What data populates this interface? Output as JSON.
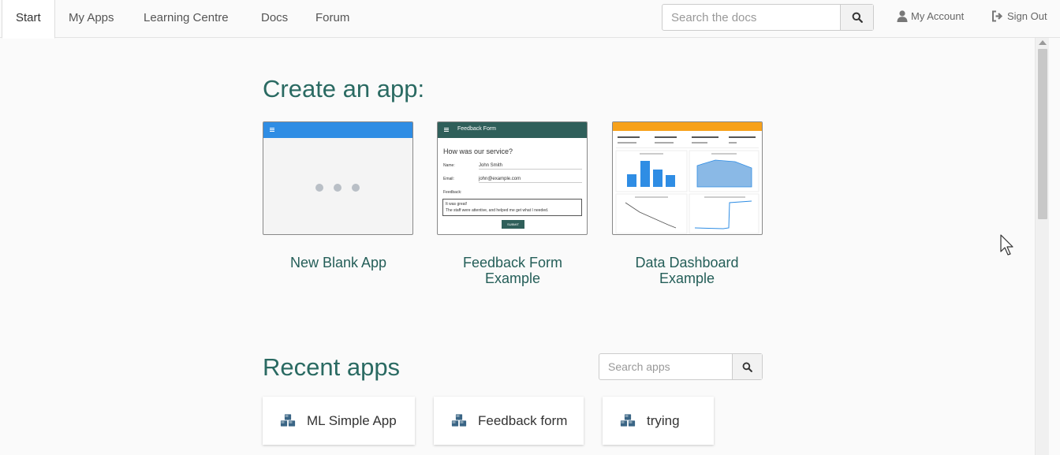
{
  "nav": {
    "tabs": [
      {
        "label": "Start",
        "active": true
      },
      {
        "label": "My Apps"
      },
      {
        "label": "Learning Centre"
      },
      {
        "label": "Docs"
      },
      {
        "label": "Forum"
      }
    ],
    "docs_search_placeholder": "Search the docs",
    "account_label": "My Account",
    "signout_label": "Sign Out"
  },
  "create": {
    "heading": "Create an app:",
    "templates": [
      {
        "title_lines": [
          "New Blank App"
        ]
      },
      {
        "title_lines": [
          "Feedback Form",
          "Example"
        ]
      },
      {
        "title_lines": [
          "Data Dashboard",
          "Example"
        ]
      }
    ]
  },
  "feedback_preview": {
    "header": "Feedback Form",
    "question": "How was our service?",
    "name_label": "Name:",
    "name_value": "John Smith",
    "email_label": "Email:",
    "email_value": "john@example.com",
    "feedback_label": "Feedback:",
    "feedback_line1": "It was great!",
    "feedback_line2": "The staff were attentive, and helped me get what I needed.",
    "submit_label": "SUBMIT"
  },
  "recent": {
    "heading": "Recent apps",
    "search_placeholder": "Search apps",
    "apps": [
      "ML Simple App",
      "Feedback form",
      "trying"
    ]
  },
  "colors": {
    "accent": "#2a6a62",
    "blank_header": "#2f8de4",
    "feedback_header": "#2f5f5a",
    "dashboard_header": "#f7a11a",
    "bar": "#2f8de4"
  }
}
